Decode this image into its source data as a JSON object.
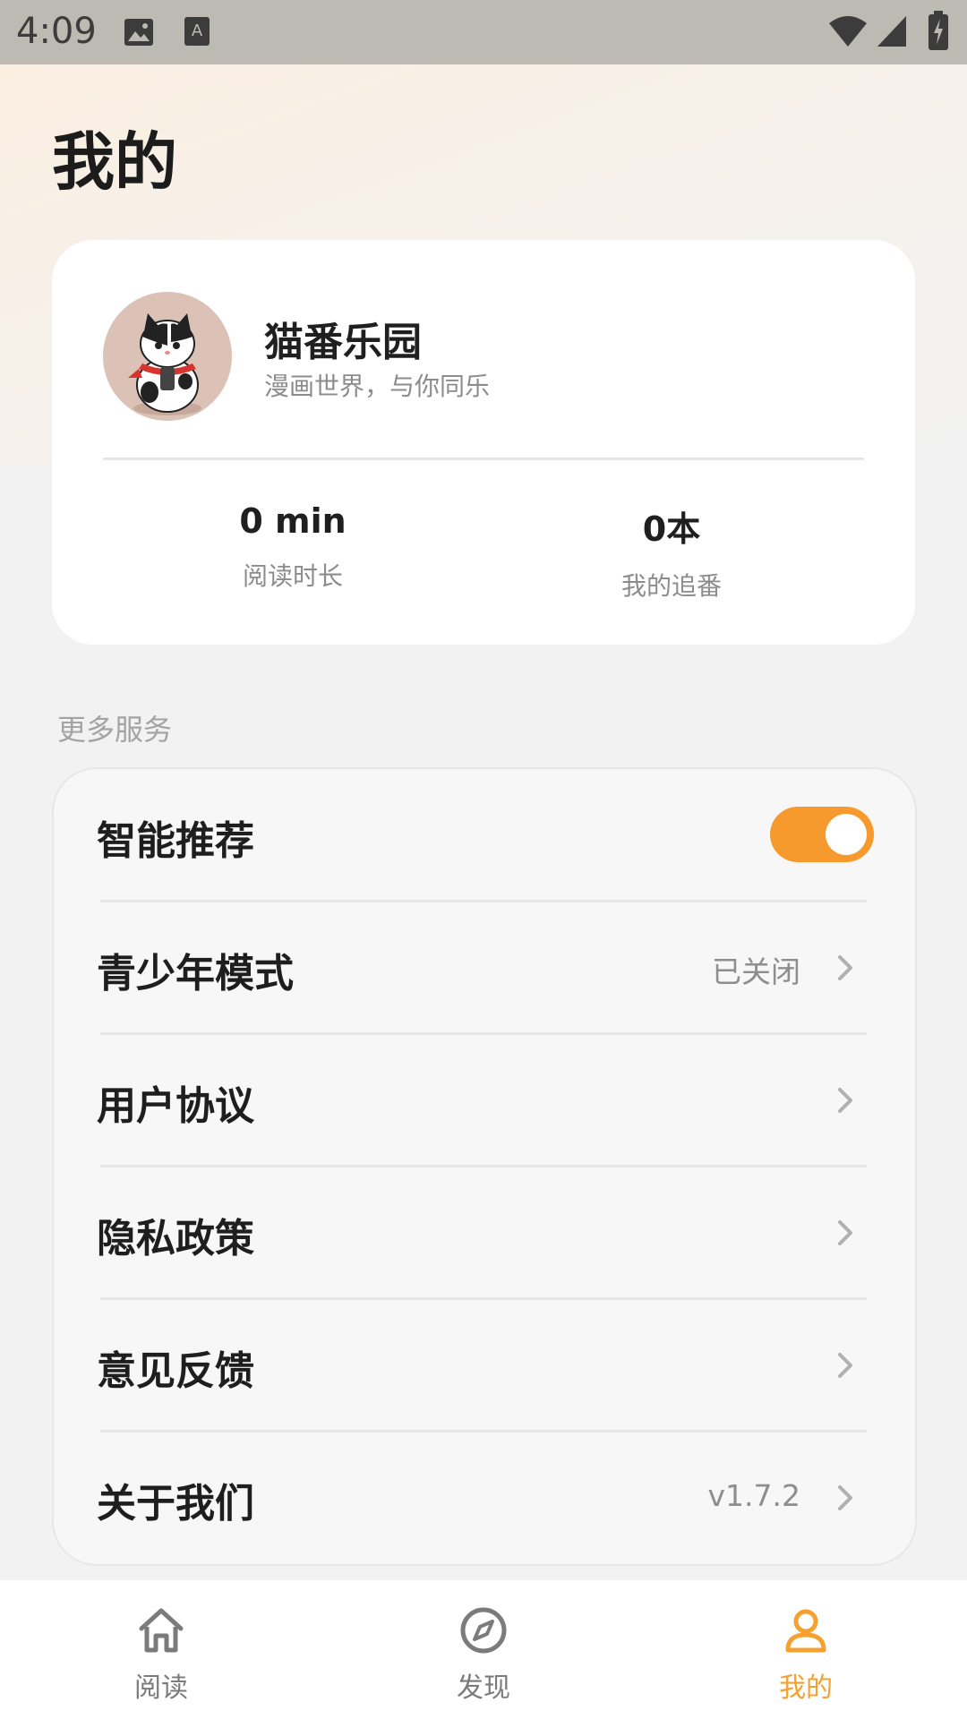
{
  "status_bar": {
    "time": "4:09"
  },
  "page": {
    "title": "我的"
  },
  "profile": {
    "name": "猫番乐园",
    "slogan": "漫画世界，与你同乐",
    "stats": [
      {
        "value": "0 min",
        "label": "阅读时长"
      },
      {
        "value": "0本",
        "label": "我的追番"
      }
    ]
  },
  "services": {
    "section_label": "更多服务",
    "items": [
      {
        "label": "智能推荐",
        "toggle_on": true
      },
      {
        "label": "青少年模式",
        "value": "已关闭"
      },
      {
        "label": "用户协议"
      },
      {
        "label": "隐私政策"
      },
      {
        "label": "意见反馈"
      },
      {
        "label": "关于我们",
        "value": "v1.7.2"
      }
    ]
  },
  "bottom_nav": [
    {
      "label": "阅读",
      "icon": "home-icon"
    },
    {
      "label": "发现",
      "icon": "compass-icon"
    },
    {
      "label": "我的",
      "icon": "user-icon",
      "active": true
    }
  ],
  "colors": {
    "accent": "#f79a2e",
    "active_nav": "#f5a02f",
    "inactive_nav": "#7b7b7b"
  }
}
